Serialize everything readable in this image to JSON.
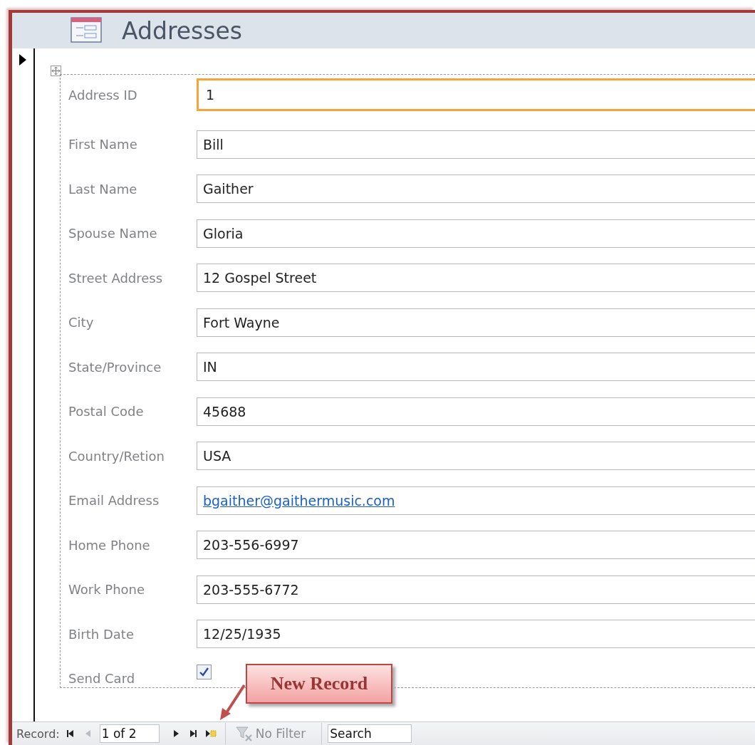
{
  "form": {
    "title": "Addresses"
  },
  "fields": [
    {
      "label": "Address ID",
      "kind": "text",
      "value": "1",
      "focused": true
    },
    {
      "label": "First Name",
      "kind": "text",
      "value": "Bill",
      "focused": false
    },
    {
      "label": "Last Name",
      "kind": "text",
      "value": "Gaither",
      "focused": false
    },
    {
      "label": "Spouse Name",
      "kind": "text",
      "value": "Gloria",
      "focused": false
    },
    {
      "label": "Street Address",
      "kind": "text",
      "value": "12 Gospel Street",
      "focused": false
    },
    {
      "label": "City",
      "kind": "text",
      "value": "Fort Wayne",
      "focused": false
    },
    {
      "label": "State/Province",
      "kind": "text",
      "value": "IN",
      "focused": false
    },
    {
      "label": "Postal Code",
      "kind": "text",
      "value": "45688",
      "focused": false
    },
    {
      "label": "Country/Retion",
      "kind": "text",
      "value": "USA",
      "focused": false
    },
    {
      "label": "Email Address",
      "kind": "link",
      "value": "bgaither@gaithermusic.com",
      "focused": false
    },
    {
      "label": "Home Phone",
      "kind": "text",
      "value": "203-556-6997",
      "focused": false
    },
    {
      "label": "Work Phone",
      "kind": "text",
      "value": "203-555-6772",
      "focused": false
    },
    {
      "label": "Birth Date",
      "kind": "text",
      "value": "12/25/1935",
      "focused": false
    },
    {
      "label": "Send Card",
      "kind": "checkbox",
      "checked": true,
      "focused": false
    }
  ],
  "callout": {
    "text": "New Record"
  },
  "navigation": {
    "label": "Record:",
    "position": "1 of 2",
    "buttons": [
      {
        "kind": "first",
        "disabled": false
      },
      {
        "kind": "previous",
        "disabled": true
      },
      {
        "kind": "next",
        "disabled": false
      },
      {
        "kind": "last",
        "disabled": false
      },
      {
        "kind": "new",
        "disabled": false
      }
    ],
    "filter": "No Filter",
    "search": {
      "placeholder": "Search"
    }
  }
}
